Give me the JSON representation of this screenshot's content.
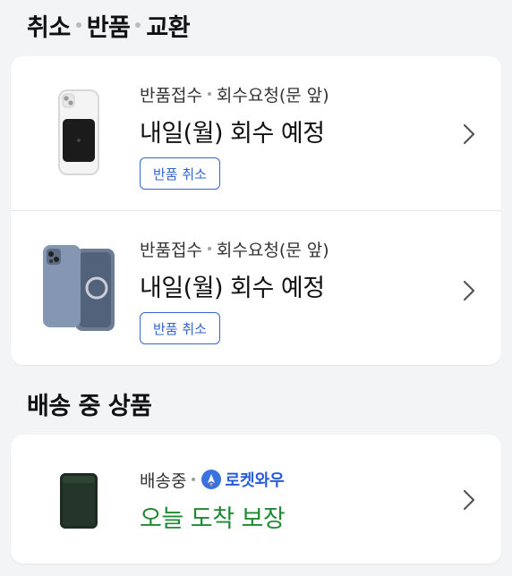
{
  "sections": {
    "cancel_return": {
      "title_parts": [
        "취소",
        "반품",
        "교환"
      ]
    },
    "shipping": {
      "title": "배송 중 상품"
    }
  },
  "return_items": [
    {
      "status_a": "반품접수",
      "status_b": "회수요청(문 앞)",
      "headline": "내일(월) 회수 예정",
      "button": "반품 취소",
      "image": "clear-phone-case-with-black-wallet-icon"
    },
    {
      "status_a": "반품접수",
      "status_b": "회수요청(문 앞)",
      "headline": "내일(월) 회수 예정",
      "button": "반품 취소",
      "image": "blue-gray-phone-case-icon"
    }
  ],
  "shipping_item": {
    "status": "배송중",
    "badge_text": "로켓와우",
    "headline": "오늘 도착 보장",
    "image": "dark-green-card-wallet-icon"
  },
  "colors": {
    "accent_blue": "#3466d4",
    "guarantee_green": "#1f8a33",
    "background": "#f3f4f6"
  }
}
